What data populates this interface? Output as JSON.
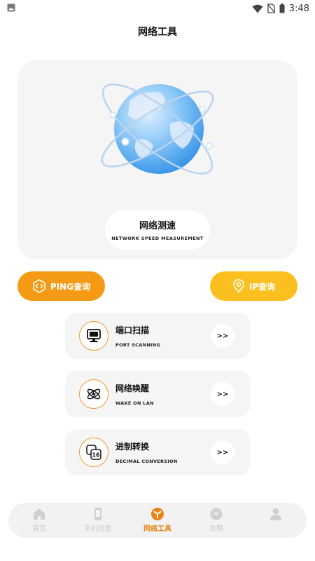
{
  "status_bar": {
    "time": "3:48"
  },
  "header": {
    "title": "网络工具"
  },
  "hero": {
    "title": "网络测速",
    "subtitle": "NETWORK SPEED MEASUREMENT"
  },
  "actions": {
    "ping_label": "PING查询",
    "ip_label": "IP查询"
  },
  "tools": [
    {
      "title": "端口扫描",
      "subtitle": "PORT SCANNING",
      "arrow": ">>",
      "icon": "monitor-icon"
    },
    {
      "title": "网络唤醒",
      "subtitle": "WAKE ON LAN",
      "arrow": ">>",
      "icon": "atom-icon"
    },
    {
      "title": "进制转换",
      "subtitle": "DECIMAL CONVERSION",
      "arrow": ">>",
      "icon": "hex-convert-icon"
    }
  ],
  "nav": [
    {
      "label": "首页",
      "icon": "home-icon",
      "active": false
    },
    {
      "label": "手机信息",
      "icon": "phone-icon",
      "active": false
    },
    {
      "label": "网络工具",
      "icon": "network-tools-icon",
      "active": true
    },
    {
      "label": "攻略",
      "icon": "guide-icon",
      "active": false
    },
    {
      "label": "",
      "icon": "user-icon",
      "active": false
    }
  ],
  "colors": {
    "accent_orange": "#f59a14",
    "accent_yellow": "#fbc020",
    "card_bg": "#f5f5f5",
    "nav_active": "#e8861a"
  }
}
